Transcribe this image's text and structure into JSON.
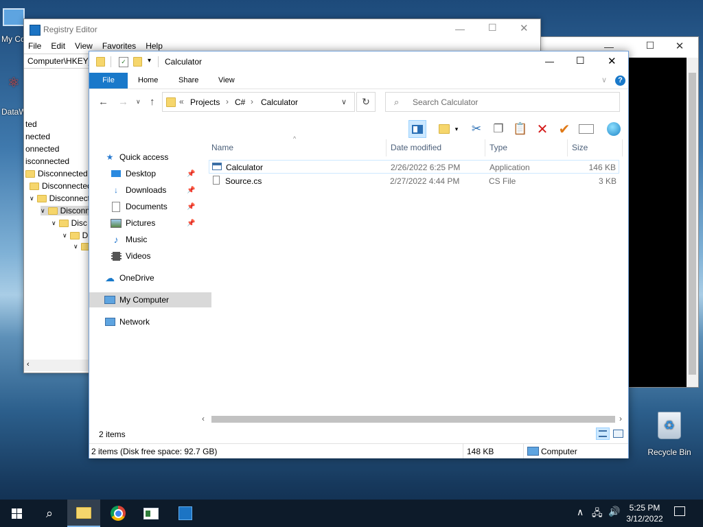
{
  "desktop": {
    "icons": [
      {
        "label": "My Co"
      },
      {
        "label": "DataW"
      },
      {
        "label": "Recycle Bin"
      }
    ]
  },
  "registry": {
    "title": "Registry Editor",
    "menu": [
      "File",
      "Edit",
      "View",
      "Favorites",
      "Help"
    ],
    "address": "Computer\\HKEY_",
    "tree": [
      "ted",
      "nected",
      "onnected",
      "isconnected",
      "Disconnected",
      "Disconnected",
      "Disconnect",
      "Disconn",
      "Disc",
      "D"
    ]
  },
  "explorer": {
    "title": "Calculator",
    "ribbon_tabs": [
      "File",
      "Home",
      "Share",
      "View"
    ],
    "breadcrumb": {
      "prefix": "«",
      "parts": [
        "Projects",
        "C#",
        "Calculator"
      ]
    },
    "search_placeholder": "Search Calculator",
    "columns": [
      "Name",
      "Date modified",
      "Type",
      "Size"
    ],
    "nav": {
      "quick_access": "Quick access",
      "quick_items": [
        "Desktop",
        "Downloads",
        "Documents",
        "Pictures",
        "Music",
        "Videos"
      ],
      "onedrive": "OneDrive",
      "my_computer": "My Computer",
      "network": "Network"
    },
    "files": [
      {
        "name": "Calculator",
        "date": "2/26/2022 6:25 PM",
        "type": "Application",
        "size": "146 KB"
      },
      {
        "name": "Source.cs",
        "date": "2/27/2022 4:44 PM",
        "type": "CS File",
        "size": "3 KB"
      }
    ],
    "item_count": "2 items",
    "status": {
      "left": "2 items (Disk free space: 92.7 GB)",
      "size": "148 KB",
      "location": "Computer"
    }
  },
  "taskbar": {
    "time": "5:25 PM",
    "date": "3/12/2022"
  },
  "colors": {
    "accent": "#1979ca",
    "selection": "#cce8ff",
    "nav_selected": "#d9d9d9"
  }
}
